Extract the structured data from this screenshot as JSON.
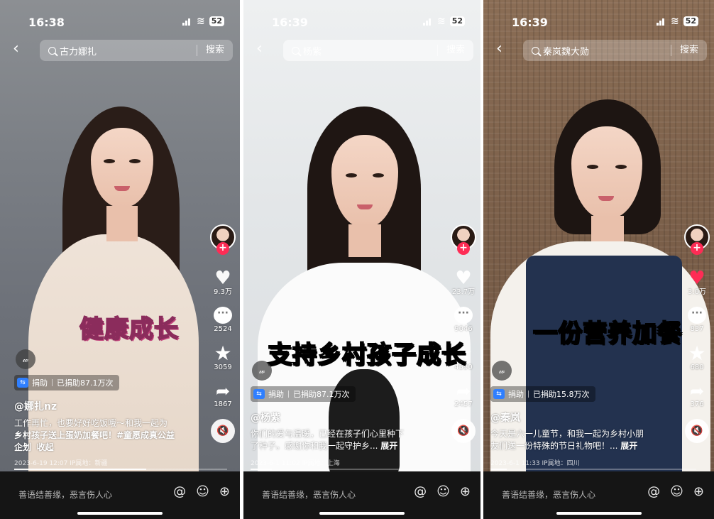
{
  "phones": [
    {
      "time": "16:38",
      "battery": "52",
      "search_query": "古力娜扎",
      "search_button": "搜索",
      "likes": "9.3万",
      "comments": "2524",
      "favorites": "3059",
      "shares": "1867",
      "caption": "健康成长",
      "topic": "𝓌",
      "donate_label": "捐助",
      "donate_amount": "已捐助87.1万次",
      "author": "@娜扎nz",
      "desc_line1": "工作再忙，也要好好吃饭哦～和我一起为",
      "desc_line2": "乡村孩子送上蛋奶加餐吧！#童愿成真公益",
      "desc_line3": "企划",
      "desc_more": "收起",
      "meta": "2023-6-19 12:07  IP属地：新疆",
      "progress": 0.62,
      "comment_placeholder": "善语结善缘，恶言伤人心"
    },
    {
      "time": "16:39",
      "battery": "52",
      "search_query": "杨紫",
      "search_button": "搜索",
      "likes": "23.7万",
      "comments": "9046",
      "favorites": "4590",
      "shares": "2457",
      "caption": "支持乡村孩子成长",
      "topic": "𝓌",
      "donate_label": "捐助",
      "donate_amount": "已捐助87.1万次",
      "author": "@杨紫",
      "desc_line1": "你们的爱与温暖，已经在孩子们心里种下",
      "desc_line2": "了种子。感谢你和我一起守护乡...",
      "desc_more": "展开",
      "meta": "2023-6-1 11:02  IP属地：上海",
      "progress": 0.1,
      "comment_placeholder": "善语结善缘，恶言伤人心"
    },
    {
      "time": "16:39",
      "battery": "52",
      "search_query": "秦岚魏大勋",
      "search_button": "搜索",
      "likes": "3.0万",
      "comments": "837",
      "favorites": "680",
      "shares": "376",
      "caption": "一份营养加餐",
      "topic": "𝓌",
      "donate_label": "捐助",
      "donate_amount": "已捐助15.8万次",
      "author": "@秦岚",
      "desc_line1": "今天是六一儿童节，和我一起为乡村小朋",
      "desc_line2": "友们送一份特殊的节日礼物吧！...",
      "desc_more": "展开",
      "meta": "2023-6-1 11:33  IP属地：四川",
      "progress": 0.08,
      "comment_placeholder": "善语结善缘，恶言伤人心"
    }
  ],
  "icons": {
    "back": "‹",
    "at": "@",
    "emoji": "☺",
    "add": "⊕",
    "heart": "♥",
    "star": "★",
    "share": "➦",
    "mute": "🔇",
    "comment": "···"
  },
  "colors": {
    "accent": "#fe2c55",
    "donate_blue": "#2f7fff",
    "bottom_bar": "#151515"
  }
}
